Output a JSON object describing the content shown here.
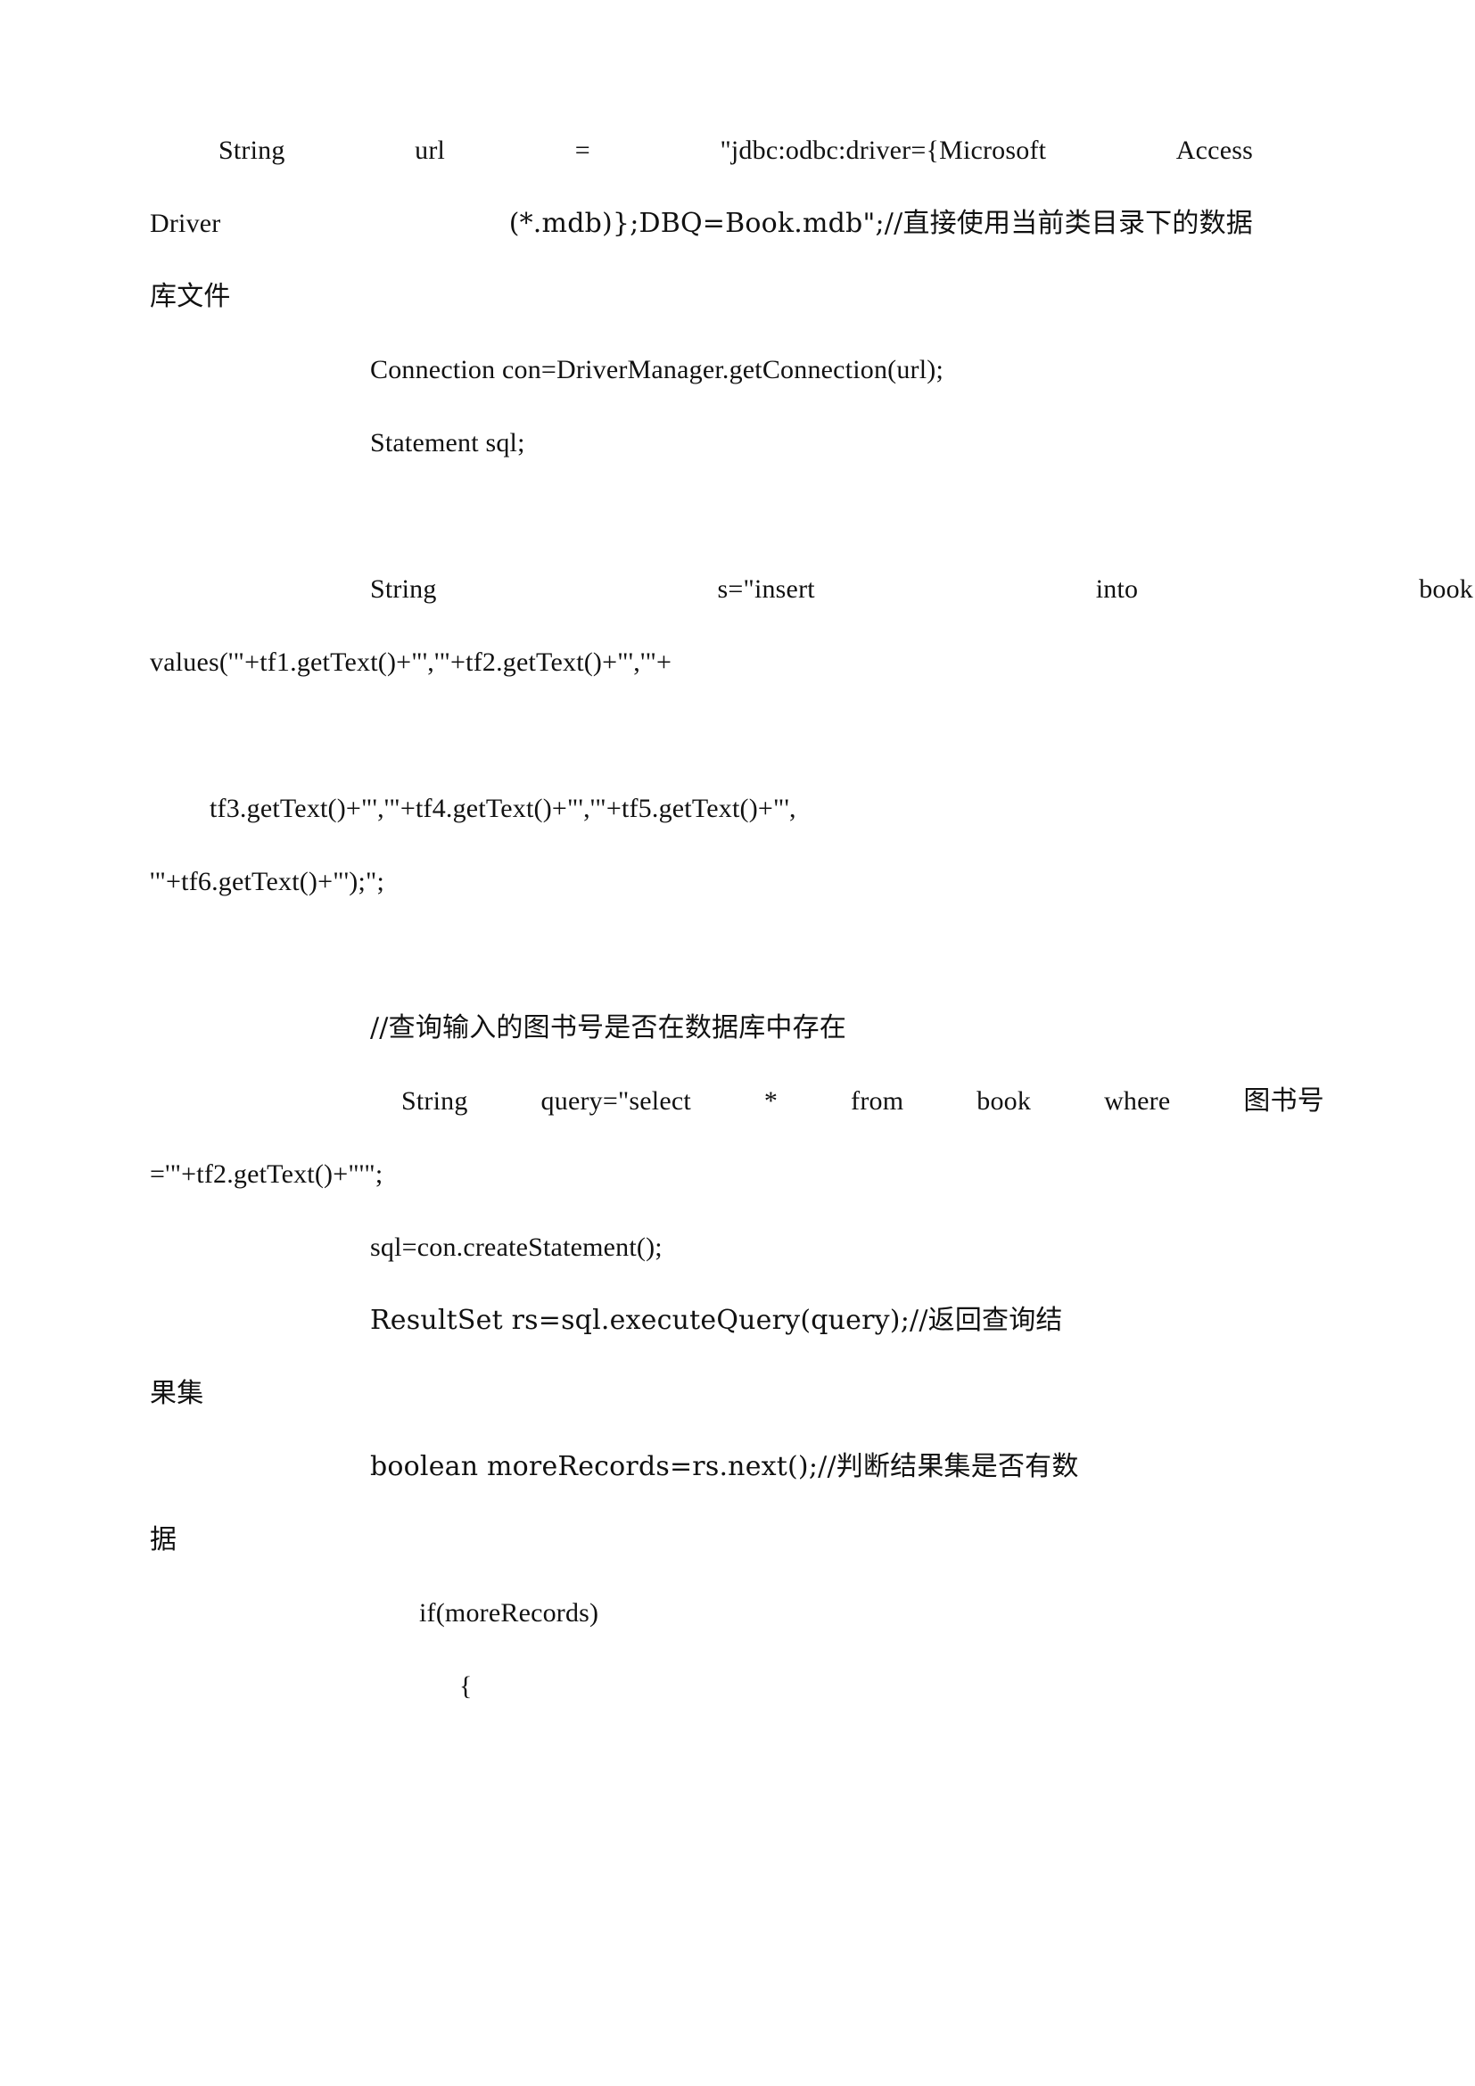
{
  "document": {
    "page_background": "#ffffff",
    "text_color": "#111111",
    "language": "zh-CN / java-source",
    "lines": [
      {
        "id": "l1",
        "kind": "justified",
        "segments": [
          "String",
          "url",
          "=",
          "\"jdbc:odbc:driver={Microsoft",
          "Access"
        ],
        "text": "String  url  =  \"jdbc:odbc:driver={Microsoft  Access"
      },
      {
        "id": "l2",
        "kind": "justified",
        "segments": [
          "Driver",
          "(*.mdb)};DBQ=Book.mdb\";//直接使用当前类目录下的数据"
        ],
        "text": "Driver (*.mdb)};DBQ=Book.mdb\";//直接使用当前类目录下的数据"
      },
      {
        "id": "l3",
        "kind": "flush",
        "text": "库文件"
      },
      {
        "id": "l4",
        "kind": "flush-indent",
        "text": "Connection con=DriverManager.getConnection(url);"
      },
      {
        "id": "l5",
        "kind": "flush-indent",
        "text": "Statement sql;"
      },
      {
        "id": "l6",
        "kind": "blank",
        "text": ""
      },
      {
        "id": "l7",
        "kind": "justified-indent",
        "segments": [
          "String",
          "s=\"insert",
          "into",
          "book"
        ],
        "text": "String          s=\"insert          into          book"
      },
      {
        "id": "l8",
        "kind": "flush",
        "text": "values('\"+tf1.getText()+\"','\"+tf2.getText()+\"','\"+"
      },
      {
        "id": "l9",
        "kind": "blank",
        "text": ""
      },
      {
        "id": "l10",
        "kind": "flush-small-indent",
        "text": "tf3.getText()+\"','\"+tf4.getText()+\"','\"+tf5.getText()+\"',"
      },
      {
        "id": "l11",
        "kind": "flush",
        "text": "'\"+tf6.getText()+\"');\";"
      },
      {
        "id": "l12",
        "kind": "blank",
        "text": ""
      },
      {
        "id": "l13",
        "kind": "flush-indent",
        "text": "//查询输入的图书号是否在数据库中存在"
      },
      {
        "id": "l14",
        "kind": "justified-indent-deep",
        "segments": [
          "String",
          "query=\"select",
          "*",
          "from",
          "book",
          "where",
          "图书号"
        ],
        "text": "String query=\"select * from book where 图书号"
      },
      {
        "id": "l15",
        "kind": "flush",
        "text": "='\"+tf2.getText()+\"'\";"
      },
      {
        "id": "l16",
        "kind": "flush-indent",
        "text": "sql=con.createStatement();"
      },
      {
        "id": "l17",
        "kind": "flush-indent",
        "text": "ResultSet rs=sql.executeQuery(query);//返回查询结"
      },
      {
        "id": "l18",
        "kind": "flush",
        "text": "果集"
      },
      {
        "id": "l19",
        "kind": "flush-indent",
        "text": "boolean moreRecords=rs.next();//判断结果集是否有数"
      },
      {
        "id": "l20",
        "kind": "flush",
        "text": "据"
      },
      {
        "id": "l21",
        "kind": "flush-deep-indent",
        "text": "if(moreRecords)"
      },
      {
        "id": "l22",
        "kind": "flush-deepest-indent",
        "text": "{"
      }
    ]
  }
}
